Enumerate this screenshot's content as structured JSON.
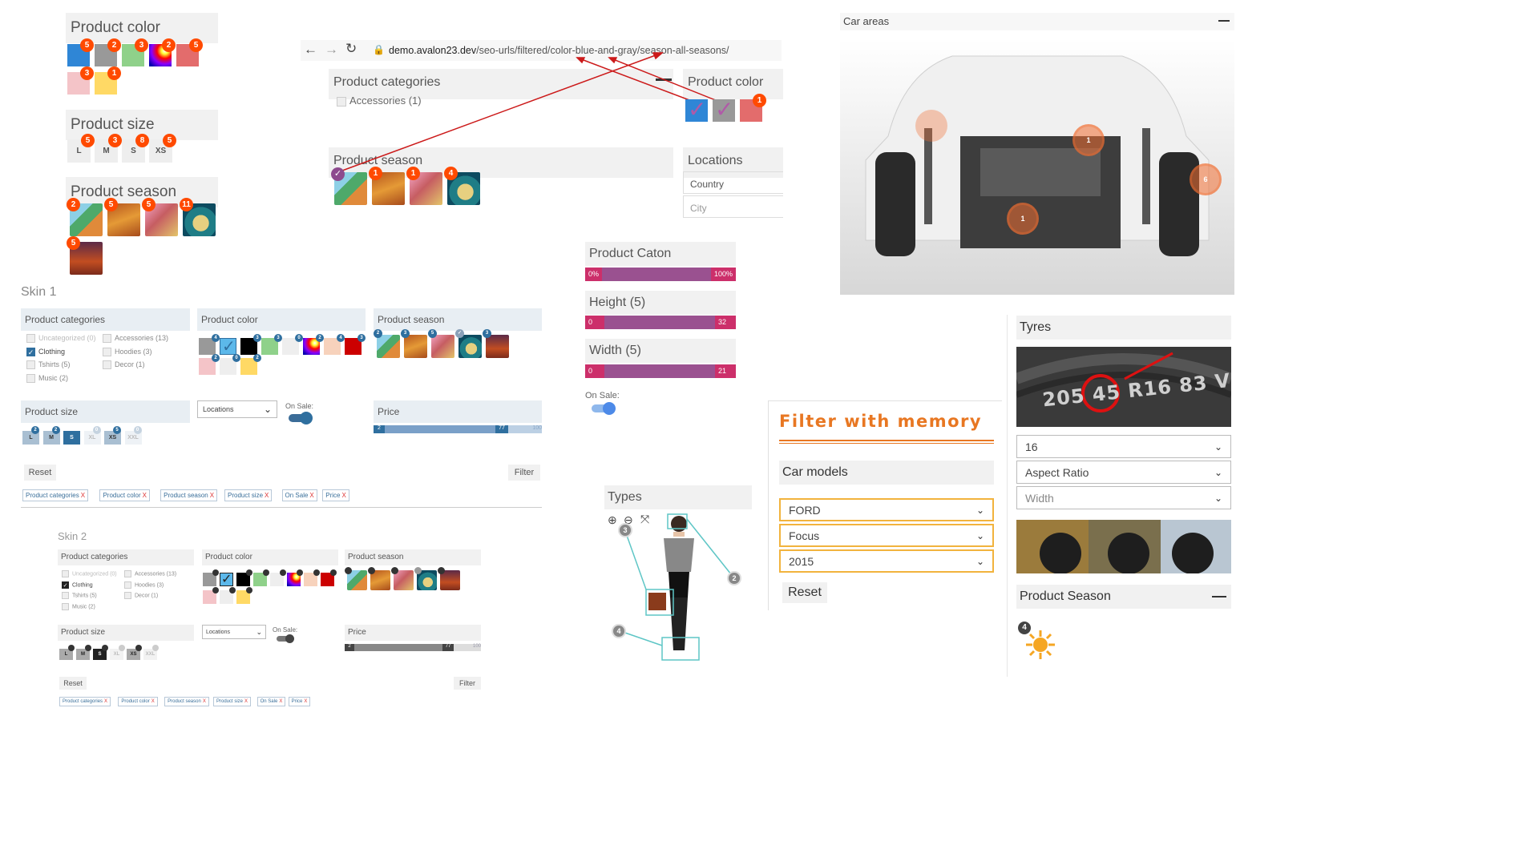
{
  "skin0": {
    "color": {
      "title": "Product color",
      "swatches": [
        {
          "color": "#2f86d6",
          "count": "5"
        },
        {
          "color": "#999999",
          "count": "2"
        },
        {
          "color": "#8fd18a",
          "count": "3"
        },
        {
          "color": "#2a1ea0",
          "count": "2"
        },
        {
          "color": "#e36c6c",
          "count": "5"
        },
        {
          "color": "#f4c4c8",
          "count": "3"
        },
        {
          "color": "#ffd965",
          "count": "1"
        }
      ]
    },
    "size": {
      "title": "Product size",
      "items": [
        {
          "label": "L",
          "count": "5"
        },
        {
          "label": "M",
          "count": "3"
        },
        {
          "label": "S",
          "count": "8"
        },
        {
          "label": "XS",
          "count": "5"
        }
      ]
    },
    "season": {
      "title": "Product season",
      "items": [
        {
          "count": "2"
        },
        {
          "count": "5"
        },
        {
          "count": "5"
        },
        {
          "count": "11"
        },
        {
          "count": "5"
        }
      ]
    }
  },
  "browser": {
    "url_host": "demo.avalon23.dev",
    "url_path": "/seo-urls/filtered/color-blue-and-gray/season-all-seasons/",
    "categories": {
      "title": "Product categories",
      "item": "Accessories (1)"
    },
    "color": {
      "title": "Product color",
      "swatches": [
        {
          "color": "#2f86d6"
        },
        {
          "color": "#999999"
        },
        {
          "color": "#e36c6c",
          "count": "1"
        }
      ]
    },
    "season": {
      "title": "Product season",
      "items": [
        {
          "count": ""
        },
        {
          "count": "1"
        },
        {
          "count": "1"
        },
        {
          "count": "4"
        }
      ]
    },
    "locations": {
      "title": "Locations",
      "country": "Country",
      "city": "City"
    }
  },
  "skin1": {
    "label": "Skin 1",
    "categories": {
      "title": "Product categories",
      "left": [
        "Uncategorized (0)",
        "Clothing",
        "Tshirts (5)",
        "Music (2)"
      ],
      "right": [
        "Accessories (13)",
        "Hoodies (3)",
        "Decor (1)"
      ]
    },
    "color": {
      "title": "Product color",
      "counts": [
        "4",
        "",
        "3",
        "3",
        "0",
        "2",
        "4",
        "3",
        "2",
        "0",
        "2"
      ]
    },
    "season": {
      "title": "Product season",
      "counts": [
        "2",
        "3",
        "5",
        "",
        "3"
      ]
    },
    "size": {
      "title": "Product size",
      "items": [
        "L",
        "M",
        "S",
        "XL",
        "XS",
        "XXL"
      ],
      "counts": [
        "2",
        "2",
        "",
        "0",
        "5",
        "0"
      ]
    },
    "locations_placeholder": "Locations",
    "on_sale": "On Sale:",
    "price": {
      "title": "Price",
      "min": "2",
      "max": "77",
      "limit": "100"
    },
    "reset": "Reset",
    "filter": "Filter",
    "chips": [
      "Product categories",
      "Product color",
      "Product season",
      "Product size",
      "On Sale",
      "Price"
    ]
  },
  "skin2": {
    "label": "Skin 2",
    "categories": {
      "title": "Product categories",
      "left": [
        "Uncategorized (0)",
        "Clothing",
        "Tshirts (5)",
        "Music (2)"
      ],
      "right": [
        "Accessories (13)",
        "Hoodies (3)",
        "Decor (1)"
      ]
    },
    "color": {
      "title": "Product color"
    },
    "season": {
      "title": "Product season"
    },
    "size": {
      "title": "Product size",
      "items": [
        "L",
        "M",
        "S",
        "XL",
        "XS",
        "XXL"
      ]
    },
    "locations_placeholder": "Locations",
    "on_sale": "On Sale:",
    "price": {
      "title": "Price",
      "min": "2",
      "max": "77",
      "limit": "100"
    },
    "reset": "Reset",
    "filter": "Filter",
    "chips": [
      "Product categories",
      "Product color",
      "Product season",
      "Product size",
      "On Sale",
      "Price"
    ]
  },
  "sliders": {
    "caton": {
      "title": "Product Caton",
      "min": "0%",
      "max": "100%"
    },
    "height": {
      "title": "Height (5)",
      "min": "0",
      "max": "32"
    },
    "width": {
      "title": "Width (5)",
      "min": "0",
      "max": "21"
    },
    "on_sale": "On Sale:"
  },
  "types": {
    "title": "Types",
    "hotspots": [
      "3",
      "2",
      "4"
    ]
  },
  "car": {
    "title": "Car areas",
    "hotspots": [
      "1",
      "1",
      "6"
    ]
  },
  "memory": {
    "title": "Filter with memory",
    "car_models": "Car models",
    "make": "FORD",
    "model": "Focus",
    "year": "2015",
    "reset": "Reset"
  },
  "tyres": {
    "title": "Tyres",
    "tyre_text": "205 45 R16 83 V",
    "diameter": "16",
    "aspect": "Aspect Ratio",
    "width": "Width",
    "season_title": "Product Season",
    "season_count": "4"
  },
  "colors": {
    "accent": "#ff4a00",
    "purple": "#9a5190",
    "pink": "#cc2f6a",
    "blue": "#2f6f9f",
    "orange": "#e87722",
    "gold": "#f2b33d"
  }
}
